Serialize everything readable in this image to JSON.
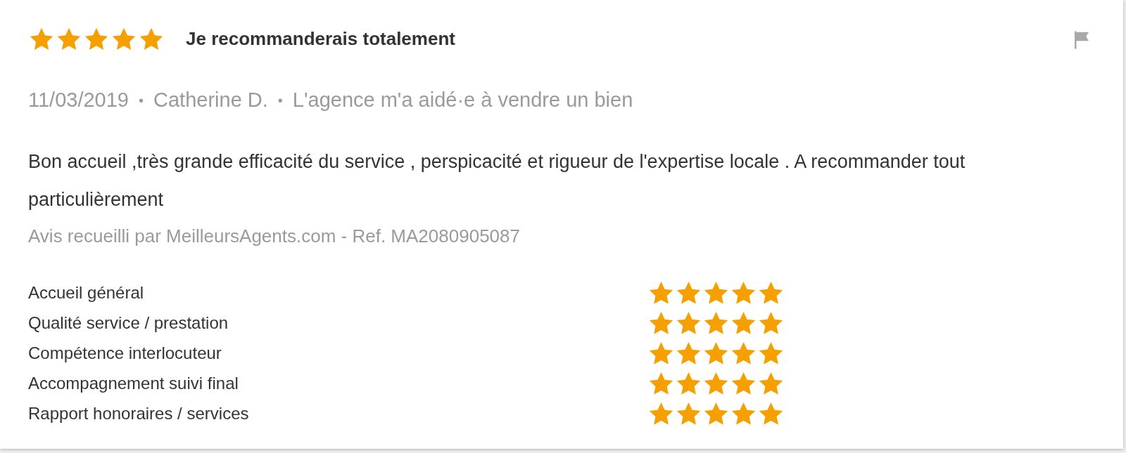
{
  "review": {
    "stars": 5,
    "title": "Je recommanderais totalement",
    "meta": [
      "11/03/2019",
      "Catherine D.",
      "L'agence m'a aidé·e à vendre un bien"
    ],
    "separator": "•",
    "body": "Bon accueil ,très grande efficacité du service , perspicacité et rigueur de l'expertise locale . A recommander tout particulièrement",
    "source": "Avis recueilli par MeilleursAgents.com - Ref. MA2080905087",
    "criteria": [
      {
        "label": "Accueil général",
        "stars": 5
      },
      {
        "label": "Qualité service / prestation",
        "stars": 5
      },
      {
        "label": "Compétence interlocuteur",
        "stars": 5
      },
      {
        "label": "Accompagnement suivi final",
        "stars": 5
      },
      {
        "label": "Rapport honoraires / services",
        "stars": 5
      }
    ]
  }
}
